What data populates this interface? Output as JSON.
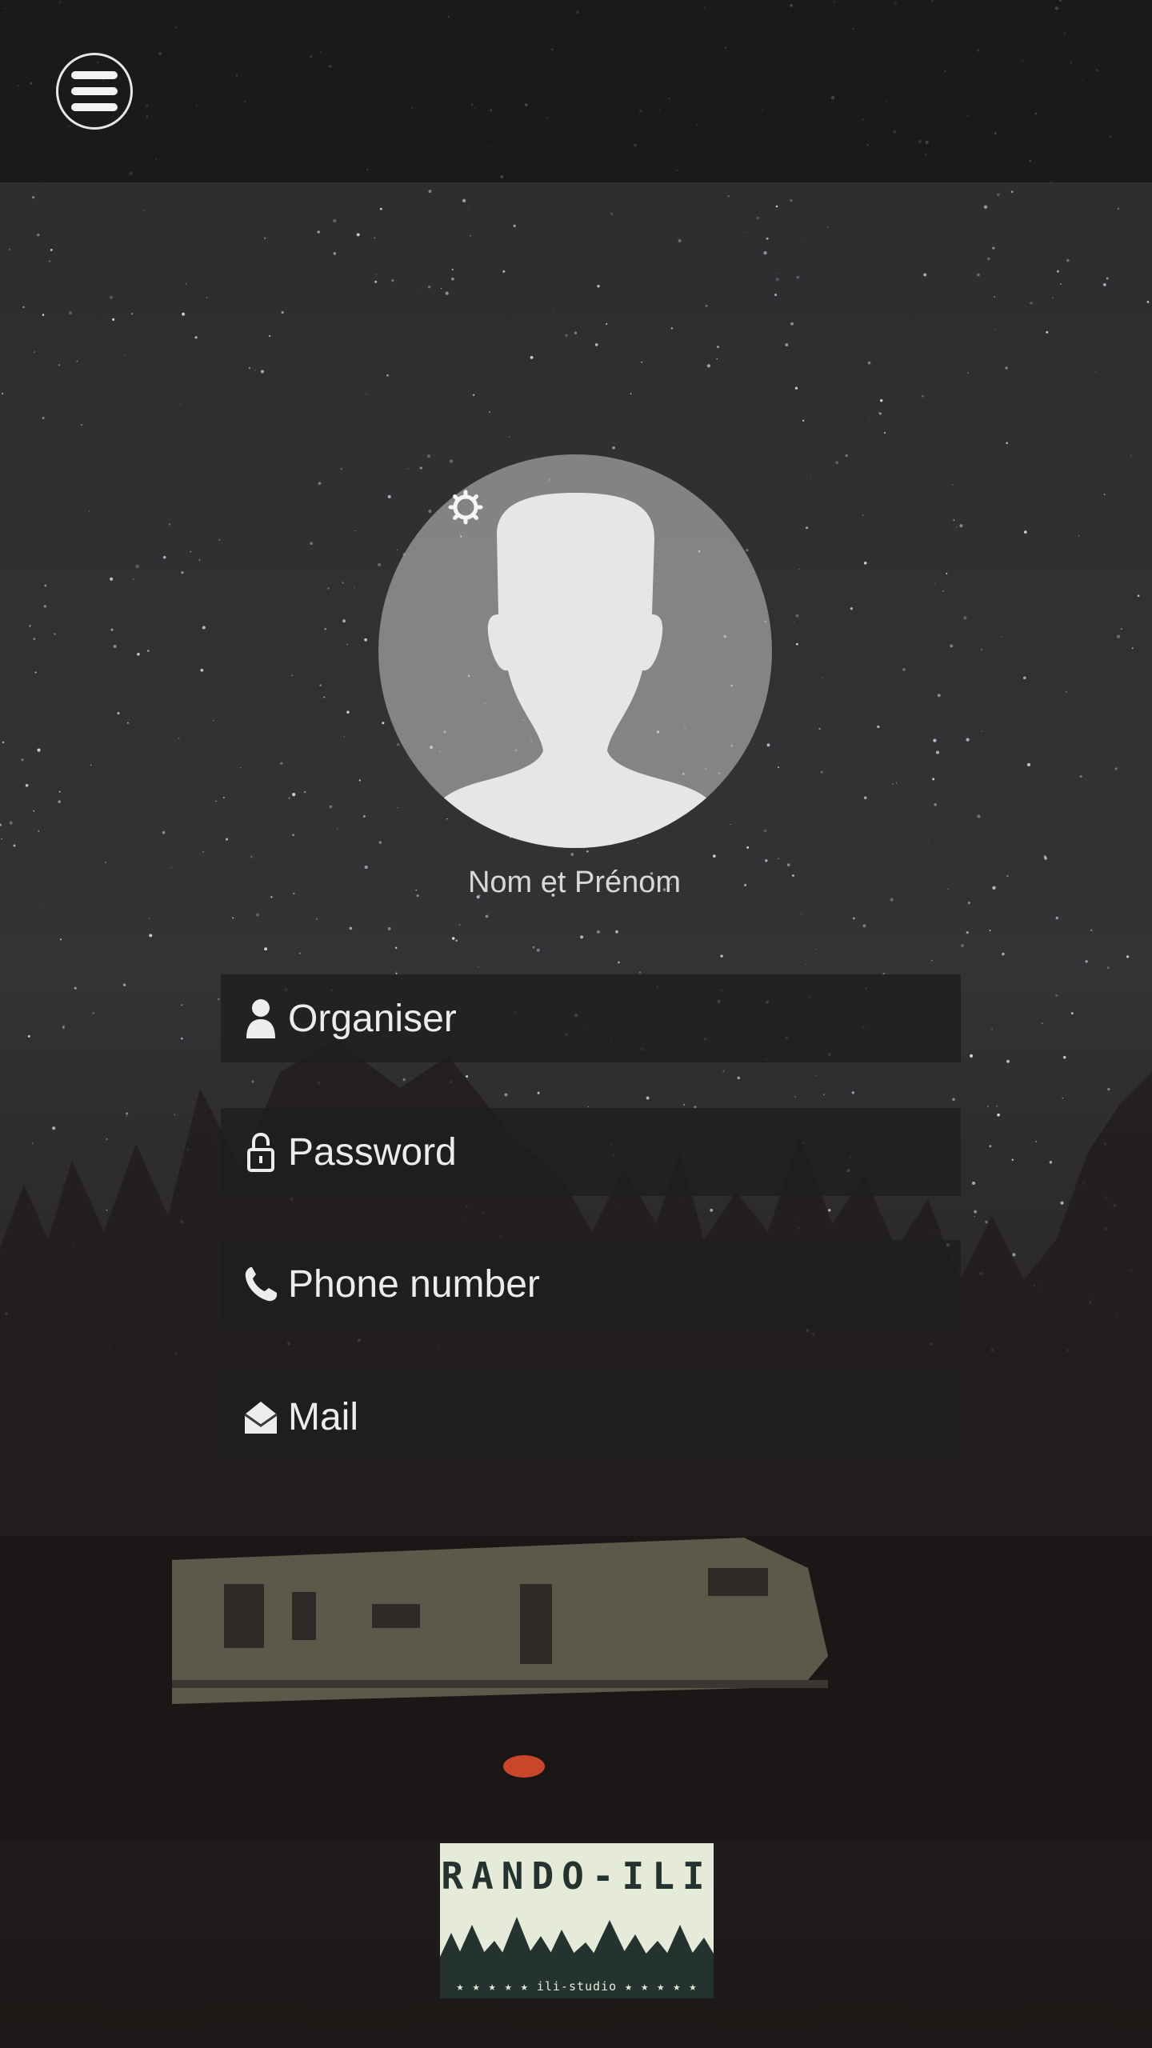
{
  "header": {
    "menu_icon": "hamburger-menu-icon"
  },
  "profile": {
    "avatar_icon": "user-silhouette-icon",
    "settings_icon": "gear-icon",
    "name_label": "Nom et Prénom"
  },
  "form": {
    "fields": [
      {
        "icon": "user-icon",
        "placeholder": "Organiser"
      },
      {
        "icon": "lock-icon",
        "placeholder": "Password"
      },
      {
        "icon": "phone-icon",
        "placeholder": "Phone number"
      },
      {
        "icon": "mail-icon",
        "placeholder": "Mail"
      }
    ]
  },
  "logo": {
    "title": "RANDO-ILI",
    "subtitle": "★ ★ ★ ★ ★ ili-studio ★ ★ ★ ★ ★"
  },
  "colors": {
    "logo_bg": "#e5ead9",
    "logo_trees": "#24332f",
    "field_bg": "#1e1e20"
  }
}
